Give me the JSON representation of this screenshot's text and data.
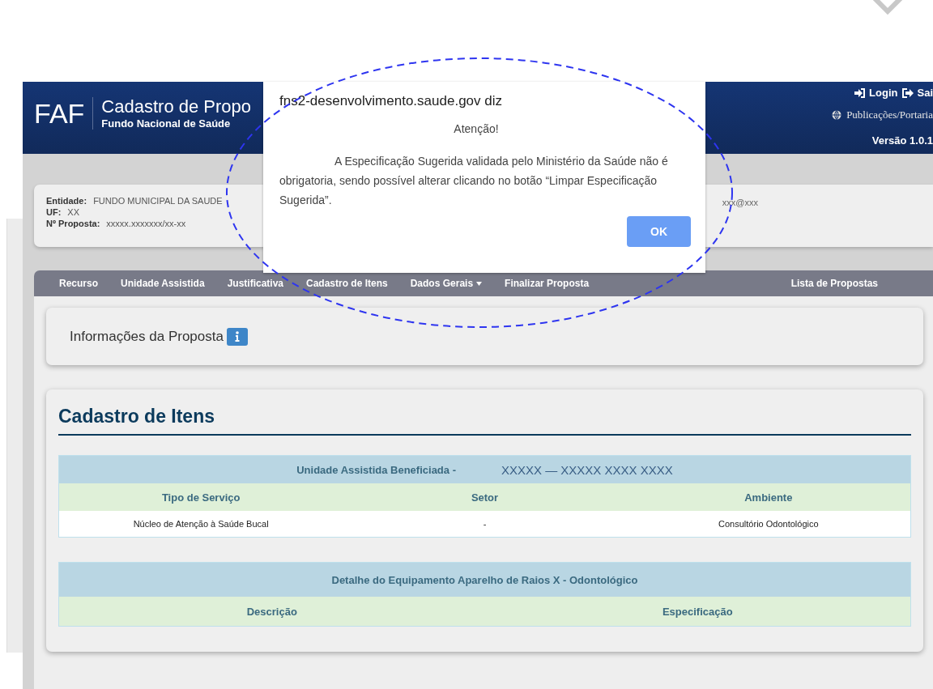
{
  "header": {
    "logo": "FAF",
    "title": "Cadastro de Propo",
    "subtitle": "Fundo Nacional de Saúde",
    "links": [
      {
        "label": "Login",
        "kind": "login"
      },
      {
        "label": "Sai",
        "kind": "logout"
      }
    ],
    "publications": "Publicações/Portaria",
    "version": "Versão 1.0.1"
  },
  "entity": {
    "fields": [
      {
        "label": "Entidade:",
        "value": "FUNDO MUNICIPAL DA SAUDE"
      },
      {
        "label": "UF:",
        "value": "XX"
      },
      {
        "label": "Nº Proposta:",
        "value": "xxxxx.xxxxxxx/xx-xx"
      }
    ],
    "email": "xxx@xxx"
  },
  "nav": {
    "items": [
      {
        "label": "Recurso",
        "dropdown": false
      },
      {
        "label": "Unidade Assistida",
        "dropdown": false
      },
      {
        "label": "Justificativa",
        "dropdown": false
      },
      {
        "label": "Cadastro de Itens",
        "dropdown": false
      },
      {
        "label": "Dados Gerais",
        "dropdown": true
      },
      {
        "label": "Finalizar Proposta",
        "dropdown": false
      }
    ],
    "right": "Lista de Propostas"
  },
  "info_card": {
    "title": "Informações da Proposta"
  },
  "items_section": {
    "title": "Cadastro de Itens",
    "unit_table": {
      "caption_label": "Unidade Assistida Beneficiada -",
      "caption_value": "XXXXX — XXXXX XXXX XXXX",
      "columns": [
        "Tipo de Serviço",
        "Setor",
        "Ambiente"
      ],
      "rows": [
        [
          "Núcleo de Atenção à Saúde Bucal",
          "-",
          "Consultório Odontológico"
        ]
      ]
    },
    "equipment_table": {
      "caption": "Detalhe do Equipamento Aparelho de Raios X - Odontológico",
      "columns": [
        "Descrição",
        "Especificação"
      ]
    }
  },
  "dialog": {
    "origin": "fns2-desenvolvimento.saude.gov diz",
    "heading": "Atenção!",
    "message": "A Especificação Sugerida validada pelo Ministério da Saúde não é obrigatoria, sendo possível alterar clicando no botão “Limpar Especificação Sugerida”.",
    "button": "OK"
  }
}
